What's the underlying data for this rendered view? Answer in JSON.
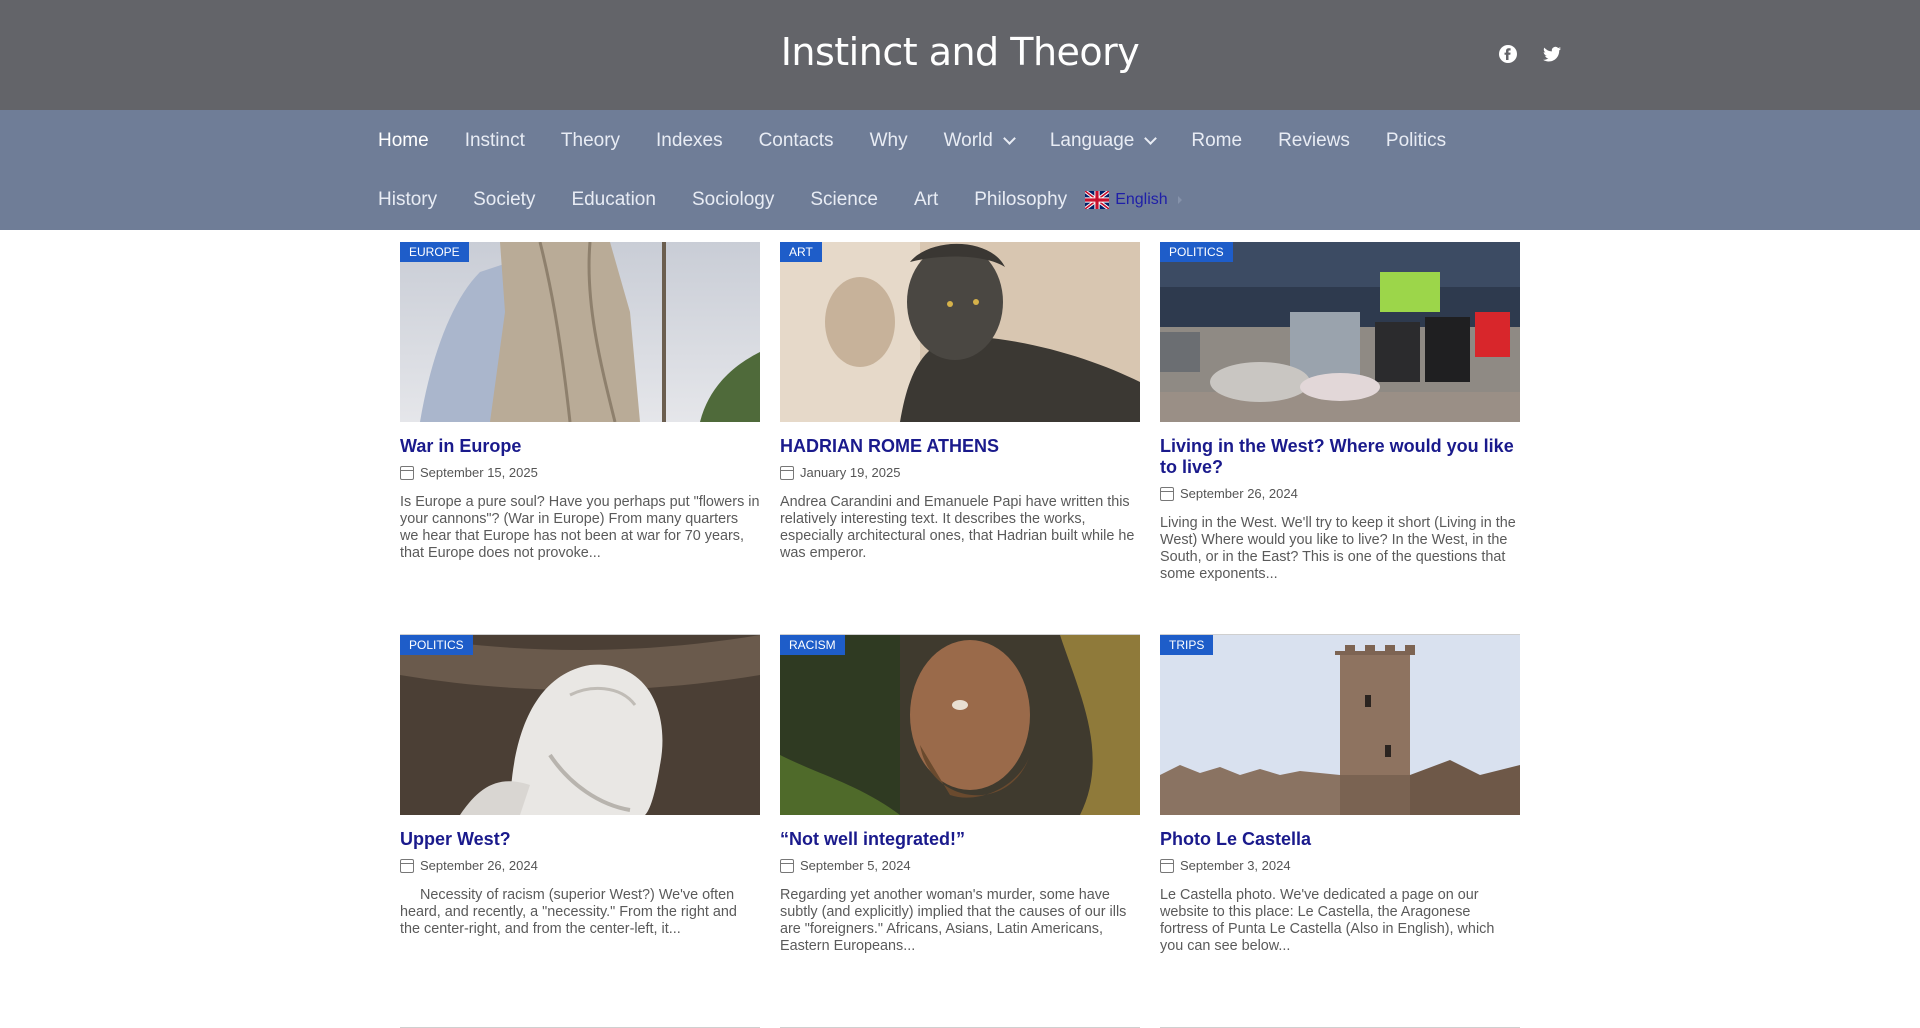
{
  "site": {
    "title": "Instinct and Theory"
  },
  "social": [
    {
      "name": "facebook-icon"
    },
    {
      "name": "twitter-icon"
    }
  ],
  "nav": {
    "row1": [
      {
        "label": "Home",
        "active": true
      },
      {
        "label": "Instinct"
      },
      {
        "label": "Theory"
      },
      {
        "label": "Indexes"
      },
      {
        "label": "Contacts"
      },
      {
        "label": "Why"
      },
      {
        "label": "World",
        "dropdown": true
      },
      {
        "label": "Language",
        "dropdown": true
      },
      {
        "label": "Rome"
      },
      {
        "label": "Reviews"
      },
      {
        "label": "Politics"
      }
    ],
    "row2": [
      {
        "label": "History"
      },
      {
        "label": "Society"
      },
      {
        "label": "Education"
      },
      {
        "label": "Sociology"
      },
      {
        "label": "Science"
      },
      {
        "label": "Art"
      },
      {
        "label": "Philosophy"
      }
    ],
    "language_switch": {
      "label": "English"
    }
  },
  "posts": [
    {
      "category": "Europe",
      "title": "War in Europe",
      "date": "September 15, 2025",
      "excerpt": "Is Europe a pure soul? Have you perhaps put \"flowers in your cannons\"? (War in Europe) From many quarters we hear that Europe has not been at war for 70 years, that Europe does not provoke..."
    },
    {
      "category": "Art",
      "title": "HADRIAN ROME ATHENS",
      "date": "January 19, 2025",
      "excerpt": "Andrea Carandini and Emanuele Papi have written this relatively interesting text. It describes the works, especially architectural ones, that Hadrian built while he was emperor."
    },
    {
      "category": "Politics",
      "title": "Living in the West? Where would you like to live?",
      "date": "September 26, 2024",
      "excerpt": "Living in the West. We'll try to keep it short (Living in the West) Where would you like to live? In the West, in the South, or in the East? This is one of the questions that some exponents..."
    },
    {
      "category": "Politics",
      "title": "Upper West?",
      "date": "September 26, 2024",
      "excerpt": "     Necessity of racism (superior West?) We've often heard, and recently, a \"necessity.\" From the right and the center-right, and from the center-left, it..."
    },
    {
      "category": "Racism",
      "title": "“Not well integrated!”",
      "date": "September 5, 2024",
      "excerpt": "Regarding yet another woman's murder, some have subtly (and explicitly) implied that the causes of our ills are \"foreigners.\" Africans, Asians, Latin Americans, Eastern Europeans..."
    },
    {
      "category": "Trips",
      "title": "Photo Le Castella",
      "date": "September 3, 2024",
      "excerpt": "Le Castella photo. We've dedicated a page on our website to this place: Le Castella, the Aragonese fortress of Punta Le Castella (Also in English), which you can see below..."
    }
  ]
}
